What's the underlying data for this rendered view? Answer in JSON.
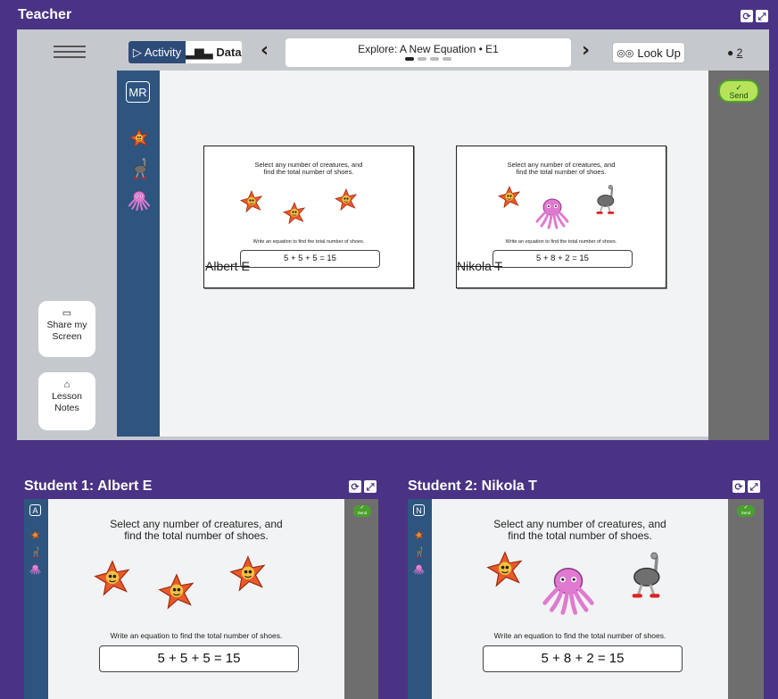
{
  "teacher": {
    "title": "Teacher",
    "toolbar": {
      "activity_label": "Activity",
      "data_label": "Data",
      "lesson_title": "Explore: A New Equation • E1",
      "look_up_label": "Look Up",
      "student_count": "2"
    },
    "sidebar": {
      "share_label_1": "Share my",
      "share_label_2": "Screen",
      "notes_label_1": "Lesson",
      "notes_label_2": "Notes"
    },
    "rail_badge": "MR",
    "send_label": "Send",
    "cards": [
      {
        "prompt_1": "Select any number of creatures, and",
        "prompt_2": "find the total number of shoes.",
        "instruction": "Write an equation to find the total number of shoes.",
        "equation": "5 + 5 + 5 = 15",
        "student_name": "Albert E"
      },
      {
        "prompt_1": "Select any number of creatures, and",
        "prompt_2": "find the total number of shoes.",
        "instruction": "Write an equation to find the total number of shoes.",
        "equation": "5 + 8 + 2 = 15",
        "student_name": "Nikola T"
      }
    ]
  },
  "students": [
    {
      "title": "Student 1: Albert E",
      "badge": "A",
      "send_label": "Send",
      "prompt_1": "Select any number of creatures, and",
      "prompt_2": "find the total number of shoes.",
      "instruction": "Write an equation to find the total number of shoes.",
      "equation": "5 + 5 + 5 = 15"
    },
    {
      "title": "Student 2: Nikola T",
      "badge": "N",
      "send_label": "Send",
      "prompt_1": "Select any number of creatures, and",
      "prompt_2": "find the total number of shoes.",
      "instruction": "Write an equation to find the total number of shoes.",
      "equation": "5 + 8 + 2 = 15"
    }
  ],
  "colors": {
    "background": "#4a3384",
    "rail": "#2e557f",
    "send": "#b6e35a",
    "starfish": "#e25a2b",
    "octopus": "#e07ad0",
    "ostrich": "#7d7d7d"
  }
}
